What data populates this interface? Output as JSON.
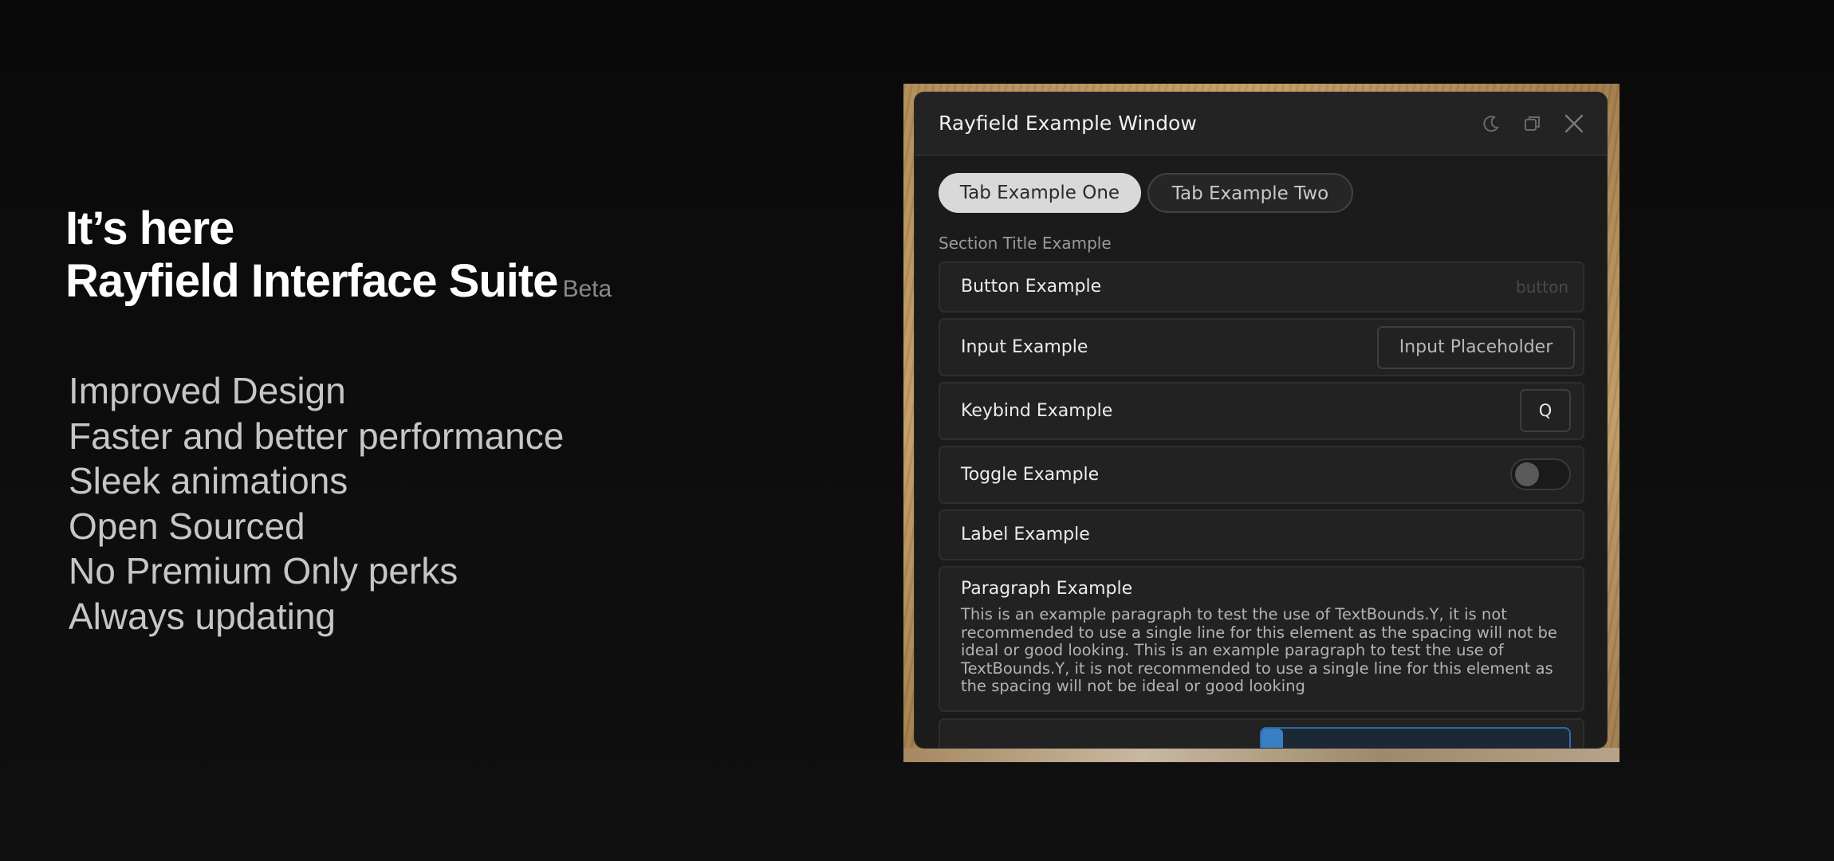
{
  "promo": {
    "intro": "It’s here",
    "title": "Rayfield Interface Suite",
    "badge": "Beta",
    "features": [
      "Improved Design",
      "Faster and better performance",
      "Sleek animations",
      "Open Sourced",
      "No Premium Only perks",
      "Always updating"
    ]
  },
  "window": {
    "title": "Rayfield Example Window",
    "icons": [
      "moon-icon",
      "minimize-icon",
      "close-icon"
    ],
    "tabs": [
      {
        "label": "Tab Example One",
        "active": true
      },
      {
        "label": "Tab Example Two",
        "active": false
      }
    ],
    "section_title": "Section Title Example",
    "button": {
      "label": "Button Example",
      "hint": "button"
    },
    "input": {
      "label": "Input Example",
      "placeholder": "Input Placeholder"
    },
    "keybind": {
      "label": "Keybind Example",
      "key": "Q"
    },
    "toggle": {
      "label": "Toggle Example",
      "on": false
    },
    "label_element": {
      "text": "Label Example"
    },
    "paragraph": {
      "title": "Paragraph Example",
      "body": "This is an example paragraph to test the use of TextBounds.Y, it is not recommended to use a single line for this element as the spacing will not be ideal or good looking. This is an example paragraph to test the use of TextBounds.Y, it is not recommended to use a single line for this element as the spacing will not be ideal or good looking"
    },
    "slider": {
      "fill_fraction": 0.07
    }
  },
  "colors": {
    "accent": "#3a7ec4",
    "window_bg": "#1b1b1b",
    "element_bg": "#222222",
    "active_tab": "#d9d9d9"
  }
}
